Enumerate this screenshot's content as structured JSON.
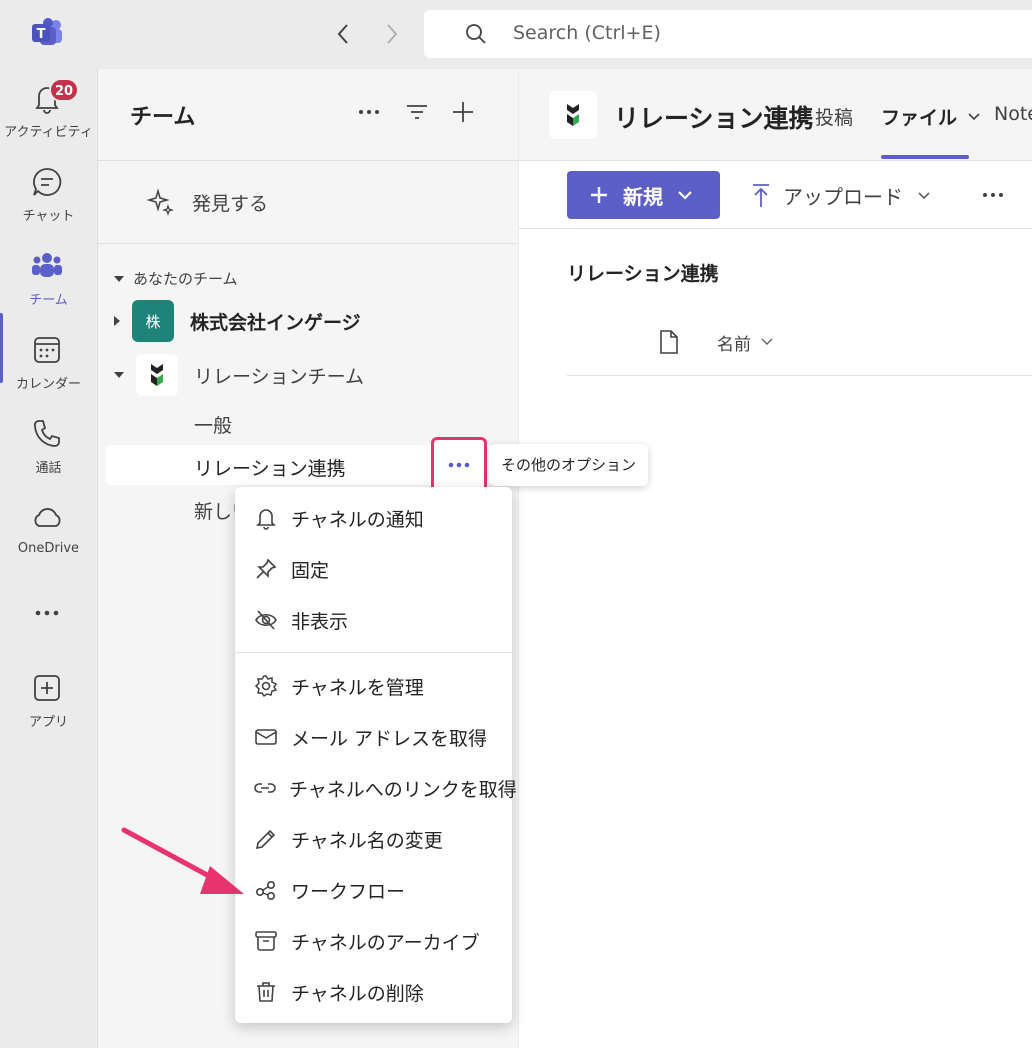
{
  "topbar": {
    "search_placeholder": "Search (Ctrl+E)"
  },
  "rail": {
    "items": [
      {
        "label": "アクティビティ",
        "badge": "20"
      },
      {
        "label": "チャット"
      },
      {
        "label": "チーム"
      },
      {
        "label": "カレンダー"
      },
      {
        "label": "通話"
      },
      {
        "label": "OneDrive"
      },
      {
        "label": "アプリ"
      }
    ]
  },
  "panel": {
    "title": "チーム",
    "discover": "発見する",
    "section": "あなたのチーム",
    "teams": [
      {
        "name": "株式会社インゲージ",
        "avatar_text": "株",
        "avatar_color": "#1e8378"
      },
      {
        "name": "リレーションチーム"
      }
    ],
    "channels": [
      "一般",
      "リレーション連携",
      "新しい"
    ],
    "tooltip": "その他のオプション"
  },
  "main": {
    "channel_title": "リレーション連携",
    "tabs": [
      "投稿",
      "ファイル",
      "Note"
    ],
    "new_label": "新規",
    "upload_label": "アップロード",
    "folder_title": "リレーション連携",
    "column_name": "名前"
  },
  "menu": {
    "items": [
      {
        "label": "チャネルの通知",
        "icon": "bell-icon"
      },
      {
        "label": "固定",
        "icon": "pin-icon"
      },
      {
        "label": "非表示",
        "icon": "eye-off-icon"
      },
      {
        "label": "チャネルを管理",
        "icon": "gear-icon"
      },
      {
        "label": "メール アドレスを取得",
        "icon": "mail-icon"
      },
      {
        "label": "チャネルへのリンクを取得",
        "icon": "link-icon"
      },
      {
        "label": "チャネル名の変更",
        "icon": "pencil-icon"
      },
      {
        "label": "ワークフロー",
        "icon": "workflow-icon"
      },
      {
        "label": "チャネルのアーカイブ",
        "icon": "archive-icon"
      },
      {
        "label": "チャネルの削除",
        "icon": "trash-icon"
      }
    ]
  },
  "colors": {
    "accent": "#5b5fc7",
    "highlight": "#e8336e",
    "badge": "#c4314b"
  }
}
